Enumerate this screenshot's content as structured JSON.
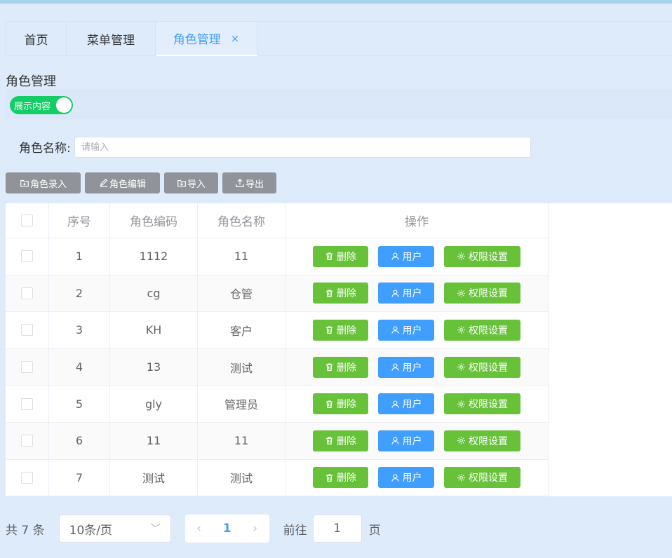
{
  "tabs": [
    {
      "label": "首页",
      "active": false
    },
    {
      "label": "菜单管理",
      "active": false
    },
    {
      "label": "角色管理",
      "active": true,
      "close": "×"
    }
  ],
  "page_title": "角色管理",
  "toggle": {
    "label": "展示内容",
    "on": true
  },
  "search": {
    "label": "角色名称:",
    "placeholder": "请输入",
    "value": ""
  },
  "toolbar": {
    "add_label": "角色录入",
    "edit_label": "角色编辑",
    "import_label": "导入",
    "export_label": "导出"
  },
  "table": {
    "headers": [
      "序号",
      "角色编码",
      "角色名称",
      "操作"
    ],
    "rows": [
      {
        "index": "1",
        "code": "1112",
        "name": "11"
      },
      {
        "index": "2",
        "code": "cg",
        "name": "仓管"
      },
      {
        "index": "3",
        "code": "KH",
        "name": "客户"
      },
      {
        "index": "4",
        "code": "13",
        "name": "测试"
      },
      {
        "index": "5",
        "code": "gly",
        "name": "管理员"
      },
      {
        "index": "6",
        "code": "11",
        "name": "11"
      },
      {
        "index": "7",
        "code": "测试",
        "name": "测试"
      }
    ],
    "actions": {
      "delete": "删除",
      "users": "用户",
      "permissions": "权限设置"
    }
  },
  "pagination": {
    "total_text": "共 7 条",
    "page_size": "10条/页",
    "current_page": "1",
    "goto_label": "前往",
    "goto_value": "1",
    "goto_suffix": "页"
  },
  "colors": {
    "accent": "#409eff",
    "success": "#67c23a",
    "toggle_on": "#13ce66",
    "neutral_button": "#909399"
  }
}
